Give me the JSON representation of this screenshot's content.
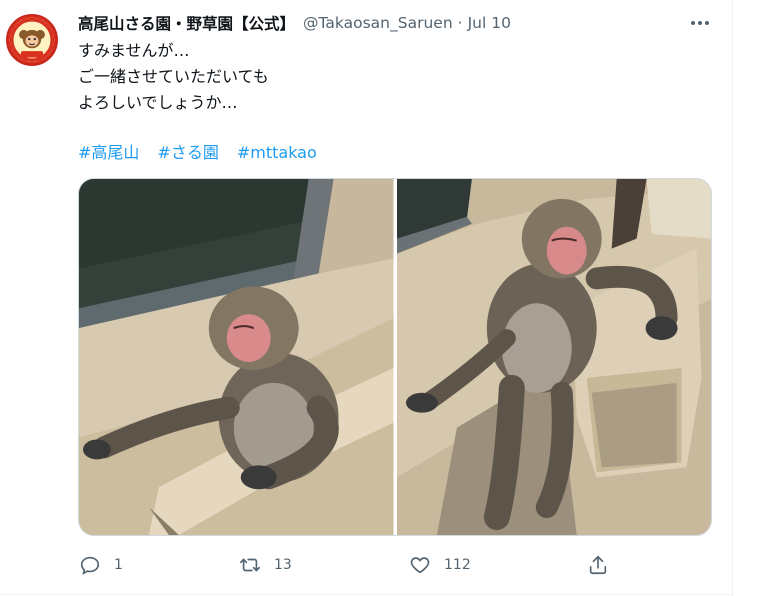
{
  "tweet": {
    "display_name": "高尾山さる園・野草園【公式】",
    "handle": "@Takaosan_Saruen",
    "separator": "·",
    "timestamp": "Jul 10",
    "text_lines": [
      "すみませんが…",
      "ご一緒させていただいても",
      "よろしいでしょうか…"
    ],
    "hashtags": [
      "#高尾山",
      "#さる園",
      "#mttakao"
    ],
    "avatar_icon": "monkey-logo",
    "more_icon": "ellipsis-icon"
  },
  "actions": {
    "reply": {
      "icon": "reply-icon",
      "count": "1"
    },
    "retweet": {
      "icon": "retweet-icon",
      "count": "13"
    },
    "like": {
      "icon": "heart-icon",
      "count": "112"
    },
    "share": {
      "icon": "share-icon",
      "count": ""
    }
  },
  "colors": {
    "text_primary": "#0f1419",
    "text_secondary": "#536471",
    "link": "#1d9bf0",
    "border": "#cfd9de"
  }
}
